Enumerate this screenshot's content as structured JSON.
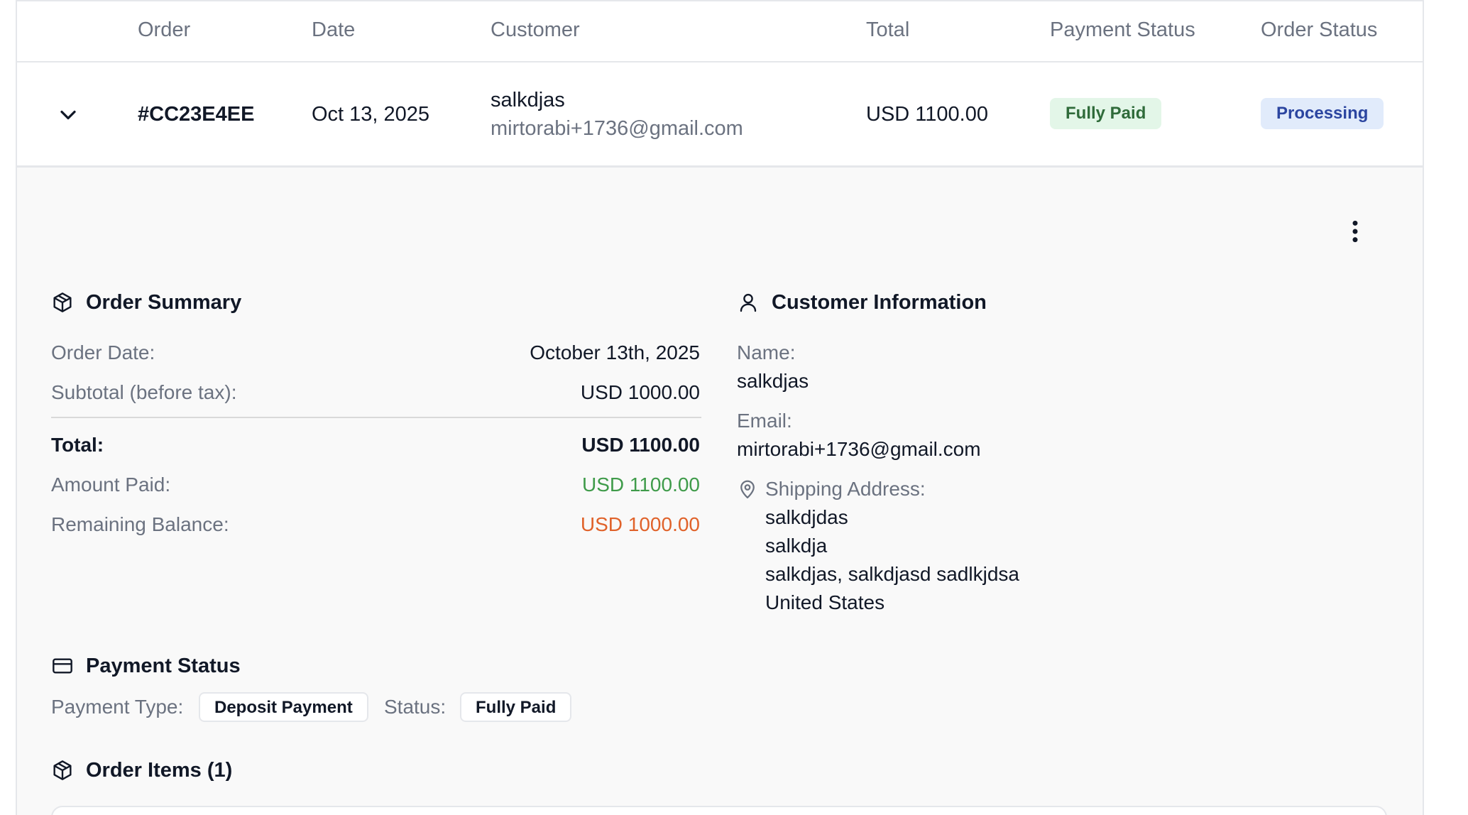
{
  "table": {
    "headers": {
      "order": "Order",
      "date": "Date",
      "customer": "Customer",
      "total": "Total",
      "payment_status": "Payment Status",
      "order_status": "Order Status"
    },
    "row": {
      "order_id": "#CC23E4EE",
      "date": "Oct 13, 2025",
      "customer_name": "salkdjas",
      "customer_email": "mirtorabi+1736@gmail.com",
      "total": "USD 1100.00",
      "payment_status": "Fully Paid",
      "order_status": "Processing"
    }
  },
  "details": {
    "order_summary": {
      "title": "Order Summary",
      "order_date_label": "Order Date:",
      "order_date": "October 13th, 2025",
      "subtotal_label": "Subtotal (before tax):",
      "subtotal": "USD 1000.00",
      "total_label": "Total:",
      "total": "USD 1100.00",
      "amount_paid_label": "Amount Paid:",
      "amount_paid": "USD 1100.00",
      "remaining_label": "Remaining Balance:",
      "remaining": "USD 1000.00"
    },
    "customer_info": {
      "title": "Customer Information",
      "name_label": "Name:",
      "name": "salkdjas",
      "email_label": "Email:",
      "email": "mirtorabi+1736@gmail.com",
      "shipping_label": "Shipping Address:",
      "address_lines": [
        "salkdjdas",
        "salkdja",
        "salkdjas, salkdjasd sadlkjdsa",
        "United States"
      ]
    },
    "payment_status": {
      "title": "Payment Status",
      "type_label": "Payment Type:",
      "type": "Deposit Payment",
      "status_label": "Status:",
      "status": "Fully Paid"
    },
    "order_items": {
      "title": "Order Items (1)"
    }
  },
  "colors": {
    "paid_green": "#3f9b4a",
    "balance_orange": "#e0622a",
    "fully_paid_badge_bg": "#e3f6e8",
    "fully_paid_badge_text": "#2f6b3a",
    "processing_badge_bg": "#e1ebfb",
    "processing_badge_text": "#2b45a0"
  },
  "icons": {
    "expand": "chevron-down-icon",
    "menu": "more-vertical-icon",
    "order_summary": "package-icon",
    "customer_info": "user-icon",
    "shipping": "map-pin-icon",
    "payment": "credit-card-icon",
    "order_items": "package-icon"
  }
}
